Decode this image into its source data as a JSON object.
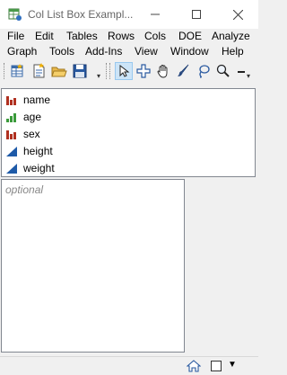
{
  "window": {
    "title": "Col List Box Exampl...",
    "minimize_glyph": "—",
    "maximize_glyph": "☐",
    "close_glyph": "✕"
  },
  "menus": {
    "row1": [
      "File",
      "Edit",
      "Tables",
      "Rows",
      "Cols",
      "DOE",
      "Analyze"
    ],
    "row2": [
      "Graph",
      "Tools",
      "Add-Ins",
      "View",
      "Window",
      "Help"
    ]
  },
  "toolbar": {
    "items": [
      "new-data-table-icon",
      "new-script-icon",
      "open-icon",
      "save-icon",
      "arrow-select-icon",
      "crosshair-icon",
      "hand-icon",
      "brush-icon",
      "lasso-icon",
      "magnifier-icon",
      "line-icon"
    ]
  },
  "column_list": {
    "items": [
      {
        "label": "name",
        "type": "nominal",
        "color": "#b03020"
      },
      {
        "label": "age",
        "type": "ordinal",
        "color": "#3a9a3a"
      },
      {
        "label": "sex",
        "type": "nominal",
        "color": "#b03020"
      },
      {
        "label": "height",
        "type": "continuous",
        "color": "#1e5aa8"
      },
      {
        "label": "weight",
        "type": "continuous",
        "color": "#1e5aa8"
      }
    ]
  },
  "optional_box": {
    "placeholder": "optional"
  },
  "statusbar": {
    "home_icon": "home-icon",
    "window_icon": "window-icon",
    "dropdown_glyph": "▼"
  }
}
